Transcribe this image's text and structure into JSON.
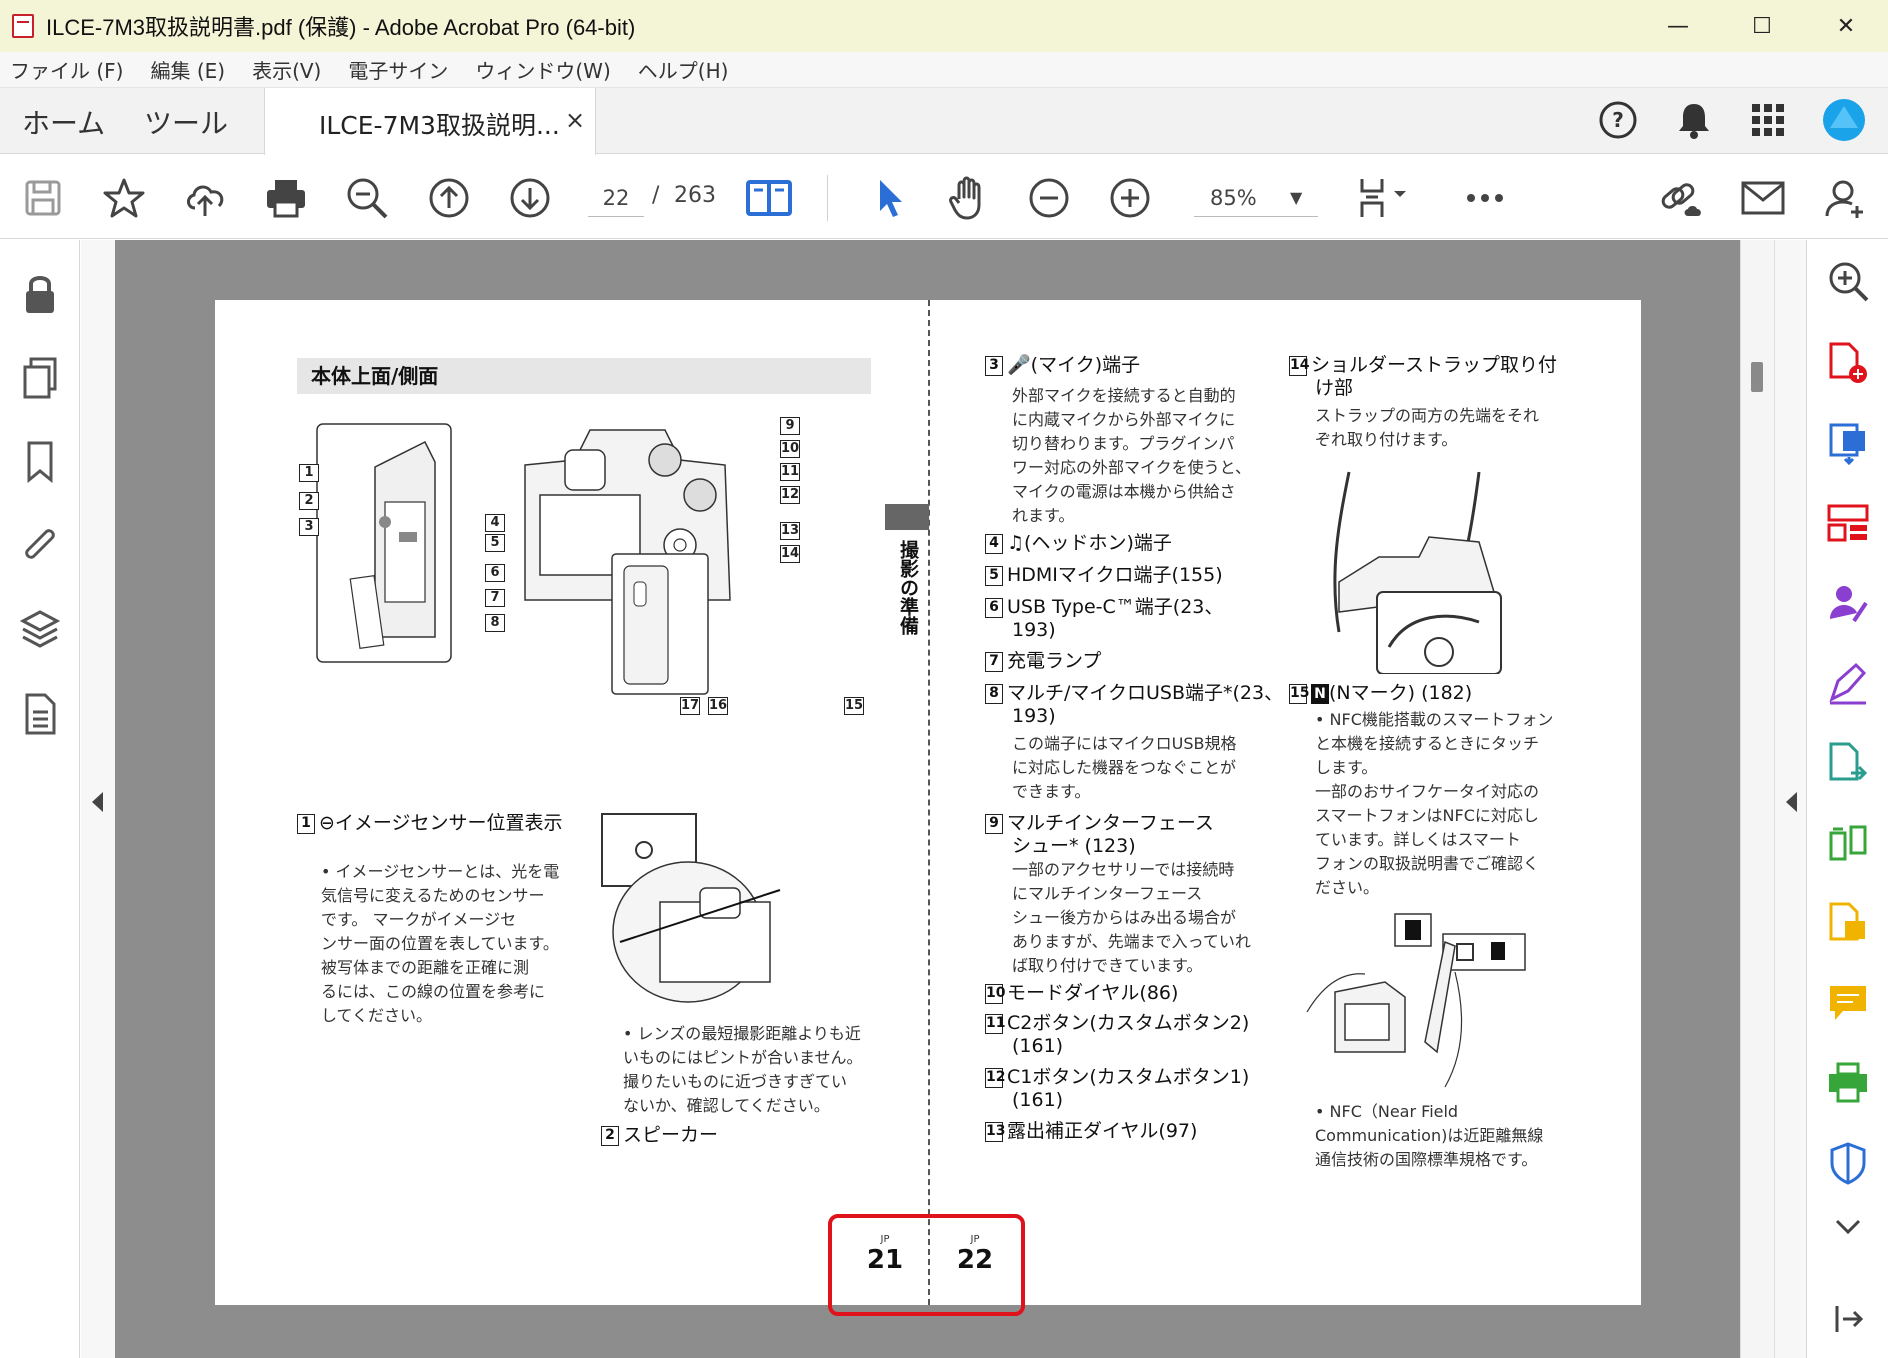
{
  "window": {
    "title": "ILCE-7M3取扱説明書.pdf (保護) - Adobe Acrobat Pro (64-bit)",
    "minimize": "—",
    "maximize": "☐",
    "close": "✕"
  },
  "menu": [
    "ファイル (F)",
    "編集 (E)",
    "表示(V)",
    "電子サイン",
    "ウィンドウ(W)",
    "ヘルプ(H)"
  ],
  "tabs": {
    "home": "ホーム",
    "tools": "ツール",
    "document": "ILCE-7M3取扱説明...",
    "close": "×"
  },
  "toolbar": {
    "page_current": "22",
    "page_sep": "/",
    "page_total": "263",
    "zoom": "85%"
  },
  "colors": {
    "titlebar": "#f4f4d6",
    "accent_blue": "#2b6fd6",
    "red": "#e0131d",
    "purple": "#8a3fd1",
    "green": "#37a63a",
    "yellow": "#f0b400"
  },
  "pdf": {
    "section_title": "本体上面/側面",
    "side_label": "撮影の準備",
    "callouts": [
      "1",
      "2",
      "3",
      "4",
      "5",
      "6",
      "7",
      "8",
      "9",
      "10",
      "11",
      "12",
      "13",
      "14",
      "15",
      "16",
      "17"
    ],
    "left_items": {
      "i1_num": "1",
      "i1_title": "イメージセンサー位置表示",
      "i1_desc": [
        "• イメージセンサーとは、光を電",
        "気信号に変えるためのセンサー",
        "です。   マークがイメージセ",
        "ンサー面の位置を表しています。",
        "被写体までの距離を正確に測",
        "るには、この線の位置を参考に",
        "してください。"
      ],
      "lens_note": [
        "• レンズの最短撮影距離よりも近",
        "いものにはピントが合いません。",
        "撮りたいものに近づきすぎてい",
        "ないか、確認してください。"
      ],
      "i2_num": "2",
      "i2_title": "スピーカー"
    },
    "mid_items": [
      {
        "num": "3",
        "title": "(マイク)端子"
      },
      {
        "num": "4",
        "title": "(ヘッドホン)端子"
      },
      {
        "num": "5",
        "title": "HDMIマイクロ端子(155)"
      },
      {
        "num": "6",
        "title": "USB Type-C™端子(23、"
      },
      {
        "num": "7",
        "title": "充電ランプ"
      },
      {
        "num": "8",
        "title": "マルチ/マイクロUSB端子*(23、"
      },
      {
        "num": "9",
        "title": "マルチインターフェース"
      },
      {
        "num": "10",
        "title": "モードダイヤル(86)"
      },
      {
        "num": "11",
        "title": "C2ボタン(カスタムボタン2)"
      },
      {
        "num": "12",
        "title": "C1ボタン(カスタムボタン1)"
      },
      {
        "num": "13",
        "title": "露出補正ダイヤル(97)"
      }
    ],
    "mid_extra": {
      "i3_desc": [
        "外部マイクを接続すると自動的",
        "に内蔵マイクから外部マイクに",
        "切り替わります。プラグインパ",
        "ワー対応の外部マイクを使うと、",
        "マイクの電源は本機から供給さ",
        "れます。"
      ],
      "i6_cont": "193)",
      "i8_cont": "193)",
      "i8_desc": [
        "この端子にはマイクロUSB規格",
        "に対応した機器をつなぐことが",
        "できます。"
      ],
      "i9_cont": "シュー* (123)",
      "i9_desc": [
        "一部のアクセサリーでは接続時",
        "にマルチインターフェース",
        "シュー後方からはみ出る場合が",
        "ありますが、先端まで入っていれ",
        "ば取り付けできています。"
      ],
      "i11_cont": "(161)",
      "i12_cont": "(161)"
    },
    "right_items": {
      "i14_num": "14",
      "i14_title": "ショルダーストラップ取り付",
      "i14_title2": "け部",
      "i14_desc": [
        "ストラップの両方の先端をそれ",
        "ぞれ取り付けます。"
      ],
      "i15_num": "15",
      "i15_title": "(Nマーク) (182)",
      "i15_desc": [
        "• NFC機能搭載のスマートフォン",
        "と本機を接続するときにタッチ",
        "します。",
        "一部のおサイフケータイ対応の",
        "スマートフォンはNFCに対応し",
        "ています。詳しくはスマート",
        "フォンの取扱説明書でご確認く",
        "ださい。"
      ],
      "nfc_note": [
        "• NFC（Near Field",
        "Communication)は近距離無線",
        "通信技術の国際標準規格です。"
      ]
    },
    "page_left": {
      "jp": "JP",
      "num": "21"
    },
    "page_right": {
      "jp": "JP",
      "num": "22"
    }
  }
}
